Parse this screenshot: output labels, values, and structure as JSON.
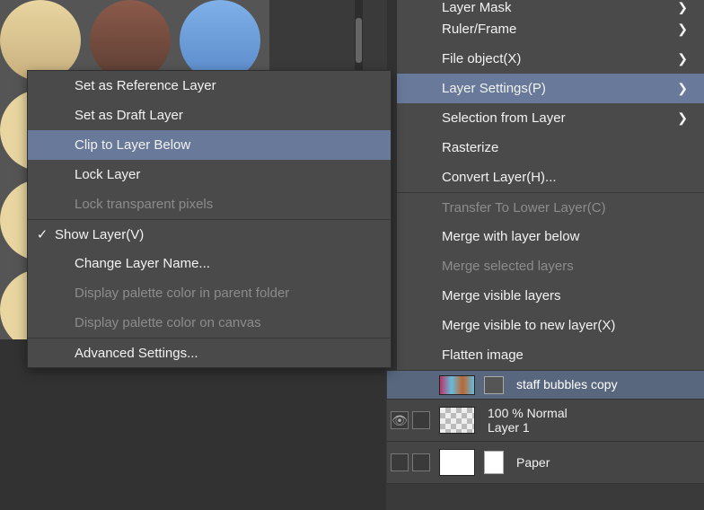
{
  "context_menu": {
    "items": [
      {
        "label": "Set as Reference Layer",
        "disabled": false,
        "checked": false,
        "newgroup": false
      },
      {
        "label": "Set as Draft Layer",
        "disabled": false,
        "checked": false,
        "newgroup": false
      },
      {
        "label": "Clip to Layer Below",
        "disabled": false,
        "checked": false,
        "highlight": true,
        "newgroup": false
      },
      {
        "label": "Lock Layer",
        "disabled": false,
        "checked": false,
        "newgroup": false
      },
      {
        "label": "Lock transparent pixels",
        "disabled": true,
        "checked": false,
        "newgroup": false
      },
      {
        "label": "Show Layer(V)",
        "disabled": false,
        "checked": true,
        "newgroup": true
      },
      {
        "label": "Change Layer Name...",
        "disabled": false,
        "checked": false,
        "newgroup": false
      },
      {
        "label": "Display palette color in parent folder",
        "disabled": true,
        "checked": false,
        "newgroup": false
      },
      {
        "label": "Display palette color on canvas",
        "disabled": true,
        "checked": false,
        "newgroup": false
      },
      {
        "label": "Advanced Settings...",
        "disabled": false,
        "checked": false,
        "newgroup": true
      }
    ]
  },
  "right_menu": {
    "items": [
      {
        "label": "Layer Mask",
        "submenu": true,
        "disabled": false,
        "cut": true
      },
      {
        "label": "Ruler/Frame",
        "submenu": true,
        "disabled": false
      },
      {
        "label": "File object(X)",
        "submenu": true,
        "disabled": false
      },
      {
        "label": "Layer Settings(P)",
        "submenu": true,
        "disabled": false,
        "highlight": true
      },
      {
        "label": "Selection from Layer",
        "submenu": true,
        "disabled": false
      },
      {
        "label": "Rasterize",
        "submenu": false,
        "disabled": false
      },
      {
        "label": "Convert Layer(H)...",
        "submenu": false,
        "disabled": false
      },
      {
        "label": "Transfer To Lower Layer(C)",
        "submenu": false,
        "disabled": true,
        "newgroup": true
      },
      {
        "label": "Merge with layer below",
        "submenu": false,
        "disabled": false
      },
      {
        "label": "Merge selected layers",
        "submenu": false,
        "disabled": true
      },
      {
        "label": "Merge visible layers",
        "submenu": false,
        "disabled": false
      },
      {
        "label": "Merge visible to new layer(X)",
        "submenu": false,
        "disabled": false
      },
      {
        "label": "Flatten image",
        "submenu": false,
        "disabled": false
      }
    ]
  },
  "layers": {
    "rows": [
      {
        "visible": true,
        "name": "staff bubbles copy",
        "opacity": "",
        "blend": "",
        "selected": true,
        "thumb": "patt"
      },
      {
        "visible": true,
        "name": "Layer 1",
        "opacity": "100 %",
        "blend": "Normal",
        "selected": false,
        "thumb": "checker"
      },
      {
        "visible": false,
        "name": "Paper",
        "opacity": "",
        "blend": "",
        "selected": false,
        "thumb": "white"
      }
    ]
  },
  "glyphs": {
    "check": "✓",
    "chevron": "❯",
    "eye": "👁"
  }
}
